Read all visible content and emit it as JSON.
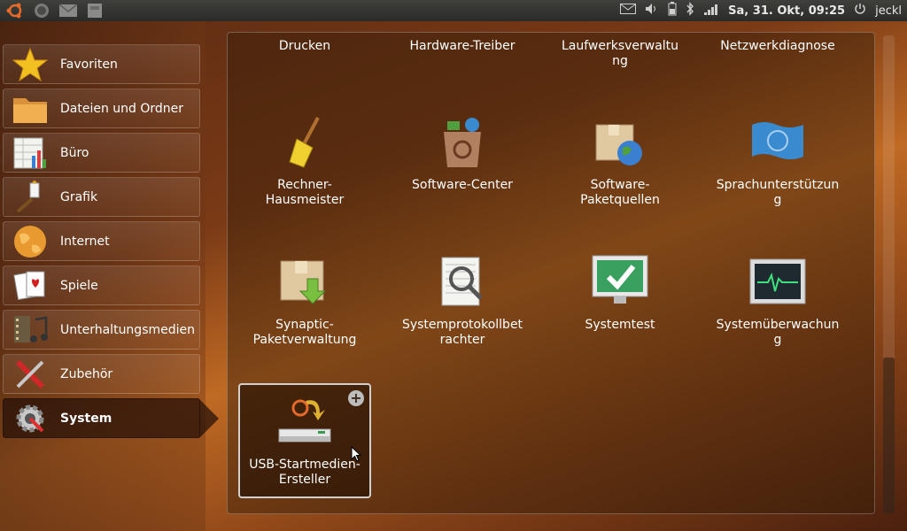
{
  "panel": {
    "clock": "Sa, 31. Okt, 09:25",
    "user": "jeckl",
    "left_icons": [
      "ubuntu-logo-icon",
      "browser-icon",
      "mail-icon",
      "files-icon"
    ],
    "right_icons": [
      "mail-indicator-icon",
      "volume-icon",
      "battery-icon",
      "bluetooth-icon",
      "network-icon",
      "power-icon"
    ]
  },
  "sidebar": {
    "items": [
      {
        "label": "Favoriten",
        "icon": "star-icon"
      },
      {
        "label": "Dateien und Ordner",
        "icon": "folder-icon"
      },
      {
        "label": "Büro",
        "icon": "spreadsheet-icon"
      },
      {
        "label": "Grafik",
        "icon": "brush-icon"
      },
      {
        "label": "Internet",
        "icon": "globe-icon"
      },
      {
        "label": "Spiele",
        "icon": "cards-icon"
      },
      {
        "label": "Unterhaltungsmedien",
        "icon": "media-icon"
      },
      {
        "label": "Zubehör",
        "icon": "tools-icon"
      },
      {
        "label": "System",
        "icon": "gear-icon",
        "active": true
      }
    ]
  },
  "apps": {
    "row0": [
      "Drucken",
      "Hardware-Treiber",
      "Laufwerksverwaltu ng",
      "Netzwerkdiagnose"
    ],
    "row1": [
      "Rechner-Hausmeister",
      "Software-Center",
      "Software-Paketquellen",
      "Sprachunterstützung"
    ],
    "row2": [
      "Synaptic-Paketverwaltung",
      "Systemprotokollbetrachter",
      "Systemtest",
      "Systemüberwachung"
    ],
    "row3": [
      "USB-Startmedien-Ersteller"
    ],
    "labels": {
      "r0c0": "Drucken",
      "r0c1": "Hardware-Treiber",
      "r0c2a": "Laufwerksverwaltu",
      "r0c2b": "ng",
      "r0c3": "Netzwerkdiagnose",
      "r1c0a": "Rechner-",
      "r1c0b": "Hausmeister",
      "r1c1": "Software-Center",
      "r1c2a": "Software-",
      "r1c2b": "Paketquellen",
      "r1c3a": "Sprachunterstützun",
      "r1c3b": "g",
      "r2c0a": "Synaptic-",
      "r2c0b": "Paketverwaltung",
      "r2c1a": "Systemprotokollbet",
      "r2c1b": "rachter",
      "r2c2": "Systemtest",
      "r2c3a": "Systemüberwachun",
      "r2c3b": "g",
      "r3c0a": "USB-Startmedien-",
      "r3c0b": "Ersteller"
    },
    "icons": [
      "broom-icon",
      "software-center-icon",
      "package-globe-icon",
      "language-flag-icon",
      "package-download-icon",
      "log-viewer-icon",
      "check-monitor-icon",
      "system-monitor-icon",
      "usb-creator-icon"
    ],
    "add_badge": "+"
  },
  "colors": {
    "accent": "#e07a2a",
    "panel": "#3a3a37"
  }
}
